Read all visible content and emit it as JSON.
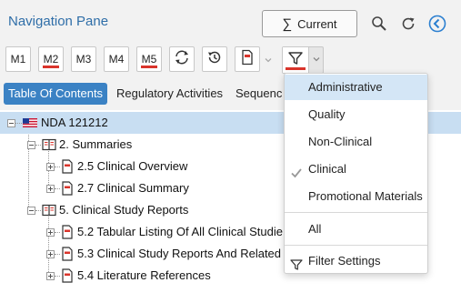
{
  "pane": {
    "title": "Navigation Pane",
    "current_label": "Current",
    "current_symbol": "∑"
  },
  "toolbar": {
    "m_buttons": [
      {
        "label": "M1",
        "active": false
      },
      {
        "label": "M2",
        "active": true
      },
      {
        "label": "M3",
        "active": false
      },
      {
        "label": "M4",
        "active": false
      },
      {
        "label": "M5",
        "active": true
      }
    ],
    "accent_color": "#d9342b"
  },
  "tabs": [
    {
      "label": "Table Of Contents",
      "active": true
    },
    {
      "label": "Regulatory Activities",
      "active": false
    },
    {
      "label": "Sequenc",
      "active": false
    }
  ],
  "tree": [
    {
      "label": "NDA 121212",
      "icon": "us-flag-icon",
      "selected": true
    },
    {
      "label": "2. Summaries",
      "icon": "book-icon"
    },
    {
      "label": "2.5 Clinical Overview",
      "icon": "document-icon"
    },
    {
      "label": "2.7 Clinical Summary",
      "icon": "document-icon"
    },
    {
      "label": "5. Clinical Study Reports",
      "icon": "book-icon"
    },
    {
      "label": "5.2 Tabular Listing Of All Clinical Studie",
      "icon": "document-icon"
    },
    {
      "label": "5.3 Clinical Study Reports And Related",
      "icon": "document-icon"
    },
    {
      "label": "5.4 Literature References",
      "icon": "document-icon"
    }
  ],
  "filter_menu": {
    "items": [
      {
        "label": "Administrative",
        "checked": false,
        "highlighted": true
      },
      {
        "label": "Quality",
        "checked": false
      },
      {
        "label": "Non-Clinical",
        "checked": false
      },
      {
        "label": "Clinical",
        "checked": true
      },
      {
        "label": "Promotional Materials",
        "checked": false
      }
    ],
    "all_label": "All",
    "settings_label": "Filter Settings"
  },
  "colors": {
    "title": "#2f6ea8",
    "active_tab": "#3b82c4",
    "selected_row": "#c8def2",
    "menu_hover": "#d4e6f6"
  }
}
